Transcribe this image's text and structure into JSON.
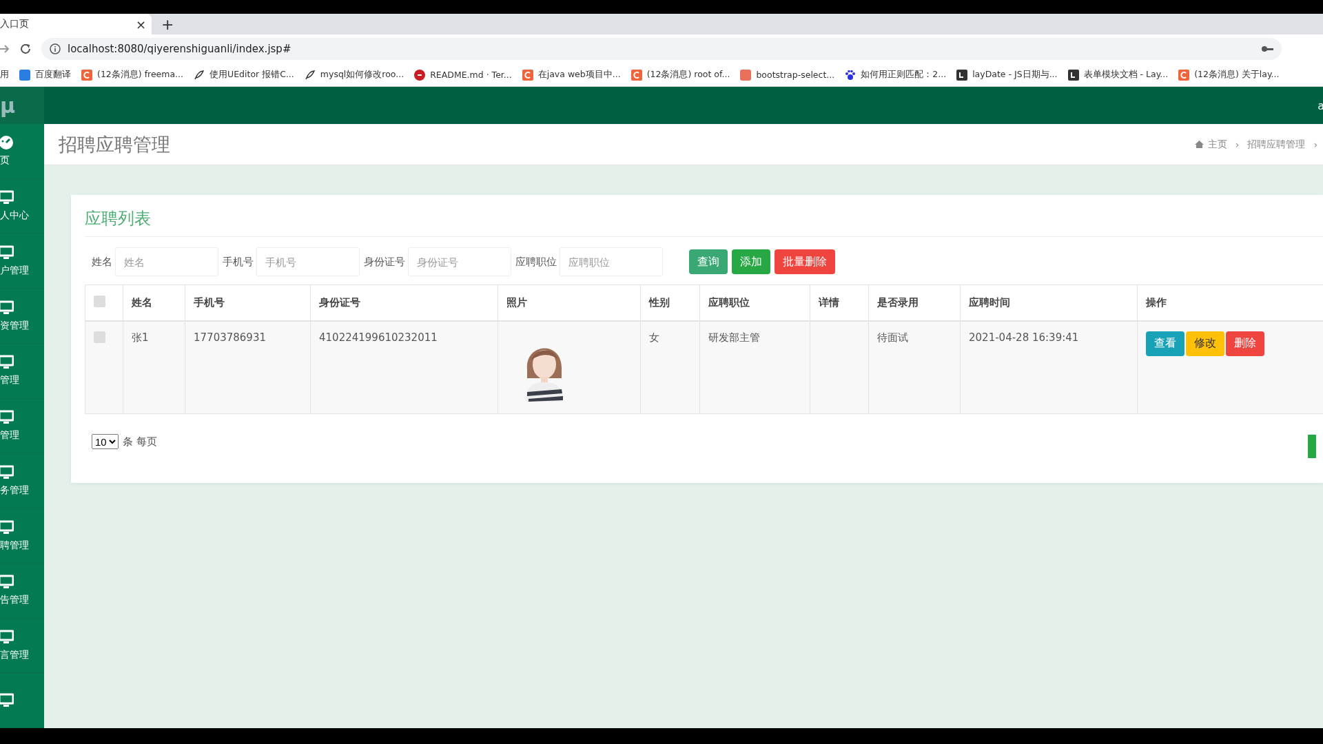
{
  "browser": {
    "tab": {
      "title": "入口页",
      "close": "×"
    },
    "new_tab": "+",
    "url": "localhost:8080/qiyerenshiguanli/index.jsp#",
    "bookmarks": [
      {
        "label": "用",
        "kind": "none"
      },
      {
        "label": "百度翻译",
        "kind": "translate"
      },
      {
        "label": "(12条消息) freema...",
        "kind": "csdn"
      },
      {
        "label": "使用UEditor 报错C...",
        "kind": "feather"
      },
      {
        "label": "mysql如何修改roo...",
        "kind": "feather"
      },
      {
        "label": "README.md · Ter...",
        "kind": "gitee"
      },
      {
        "label": "在java web项目中...",
        "kind": "csdn"
      },
      {
        "label": "(12条消息) root of...",
        "kind": "csdn"
      },
      {
        "label": "bootstrap-select...",
        "kind": "jianshu"
      },
      {
        "label": "如何用正则匹配：2...",
        "kind": "baidu"
      },
      {
        "label": "layDate - JS日期与...",
        "kind": "layui"
      },
      {
        "label": "表单模块文档 - Lay...",
        "kind": "layui"
      },
      {
        "label": "(12条消息) 关于lay...",
        "kind": "csdn"
      }
    ]
  },
  "app": {
    "logo": "μ",
    "user": "a"
  },
  "sidebar": {
    "items": [
      {
        "label": "页",
        "kind": "dashboard"
      },
      {
        "label": "人中心",
        "kind": "monitor"
      },
      {
        "label": "户管理",
        "kind": "monitor"
      },
      {
        "label": "资管理",
        "kind": "monitor"
      },
      {
        "label": "管理",
        "kind": "monitor"
      },
      {
        "label": "管理",
        "kind": "monitor"
      },
      {
        "label": "务管理",
        "kind": "monitor"
      },
      {
        "label": "聘管理",
        "kind": "monitor"
      },
      {
        "label": "告管理",
        "kind": "monitor"
      },
      {
        "label": "言管理",
        "kind": "monitor"
      },
      {
        "kind": "monitor"
      }
    ]
  },
  "page": {
    "title": "招聘应聘管理",
    "breadcrumb": [
      "主页",
      "招聘应聘管理"
    ],
    "separator": "›"
  },
  "card": {
    "title": "应聘列表",
    "filters": [
      {
        "label": "姓名",
        "placeholder": "姓名"
      },
      {
        "label": "手机号",
        "placeholder": "手机号"
      },
      {
        "label": "身份证号",
        "placeholder": "身份证号"
      },
      {
        "label": "应聘职位",
        "placeholder": "应聘职位"
      }
    ],
    "buttons": [
      {
        "label": "查询",
        "kind": "search"
      },
      {
        "label": "添加",
        "kind": "add"
      },
      {
        "label": "批量删除",
        "kind": "delete"
      }
    ],
    "table": {
      "all_checked": false,
      "columns": [
        "姓名",
        "手机号",
        "身份证号",
        "照片",
        "性别",
        "应聘职位",
        "详情",
        "是否录用",
        "应聘时间",
        "操作"
      ],
      "rows": [
        {
          "checked": false,
          "cells": [
            "张1",
            "17703786931",
            "410224199610232011",
            {
              "kind": "picture"
            },
            "女",
            "研发部主管",
            "",
            "待面试",
            "2021-04-28 16:39:41"
          ],
          "actions": [
            {
              "label": "查看",
              "kind": "view"
            },
            {
              "label": "修改",
              "kind": "edit"
            },
            {
              "label": "删除",
              "kind": "delete"
            }
          ]
        }
      ]
    },
    "page_size": {
      "value": "10",
      "suffix": "条 每页"
    }
  }
}
